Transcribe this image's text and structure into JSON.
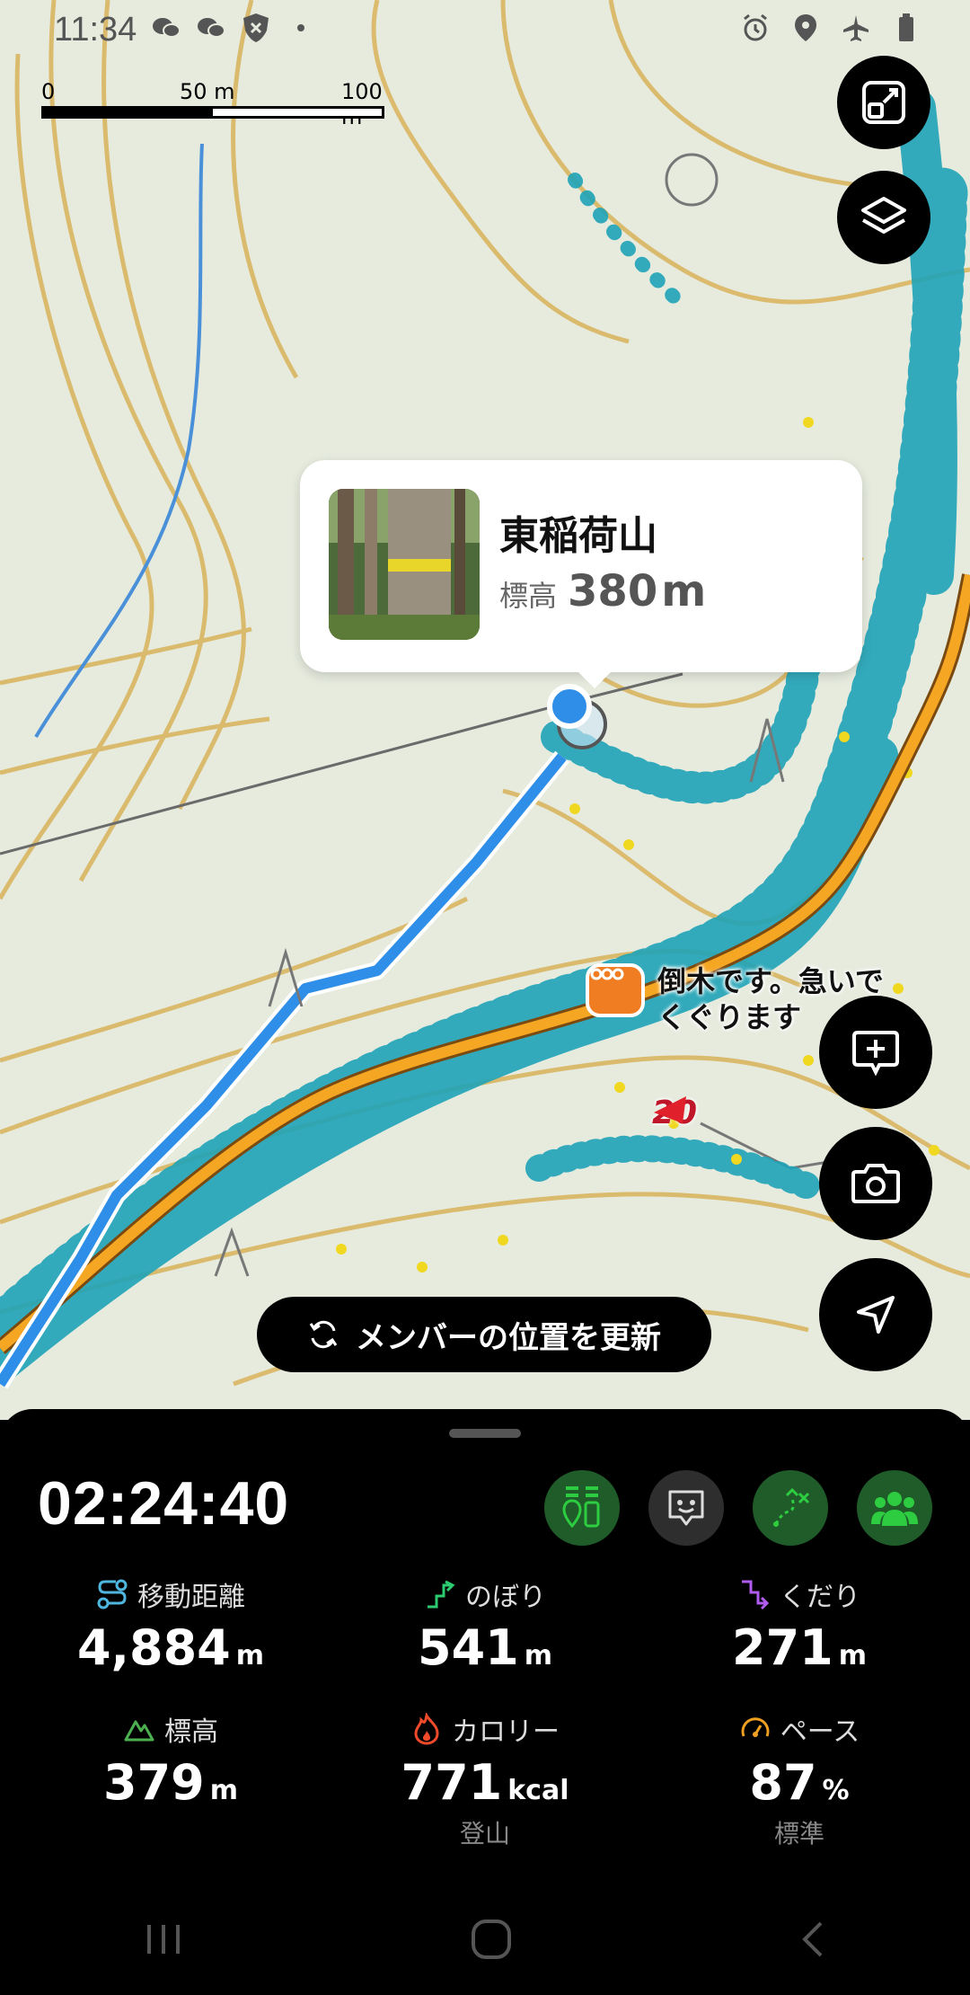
{
  "status_bar": {
    "time": "11:34"
  },
  "scale_bar": {
    "labels": [
      "0",
      "50 m",
      "100 m"
    ]
  },
  "summit_card": {
    "name": "東稲荷山",
    "elevation_label": "標高",
    "elevation_value": "380",
    "elevation_unit": "m"
  },
  "map": {
    "comment_text": "倒木です。急いでくぐります",
    "marker_label": "20"
  },
  "refresh_button": {
    "label": "メンバーの位置を更新"
  },
  "panel": {
    "elapsed": "02:24:40",
    "stats": [
      {
        "label": "移動距離",
        "value": "4,884",
        "unit": "m",
        "sub": "",
        "icon": "route-icon",
        "color": "#4fb6e0"
      },
      {
        "label": "のぼり",
        "value": "541",
        "unit": "m",
        "sub": "",
        "icon": "ascent-icon",
        "color": "#2ecc71"
      },
      {
        "label": "くだり",
        "value": "271",
        "unit": "m",
        "sub": "",
        "icon": "descent-icon",
        "color": "#b15cf0"
      },
      {
        "label": "標高",
        "value": "379",
        "unit": "m",
        "sub": "",
        "icon": "mountain-icon",
        "color": "#4caf50"
      },
      {
        "label": "カロリー",
        "value": "771",
        "unit": "kcal",
        "sub": "登山",
        "icon": "flame-icon",
        "color": "#f04a2a"
      },
      {
        "label": "ペース",
        "value": "87",
        "unit": "%",
        "sub": "標準",
        "icon": "gauge-icon",
        "color": "#f0a020"
      }
    ]
  },
  "colors": {
    "route_blue": "#2f8fe8",
    "trail_orange": "#f5a623",
    "track_teal": "#1fa3b8",
    "accent_green": "#2ecc40"
  }
}
